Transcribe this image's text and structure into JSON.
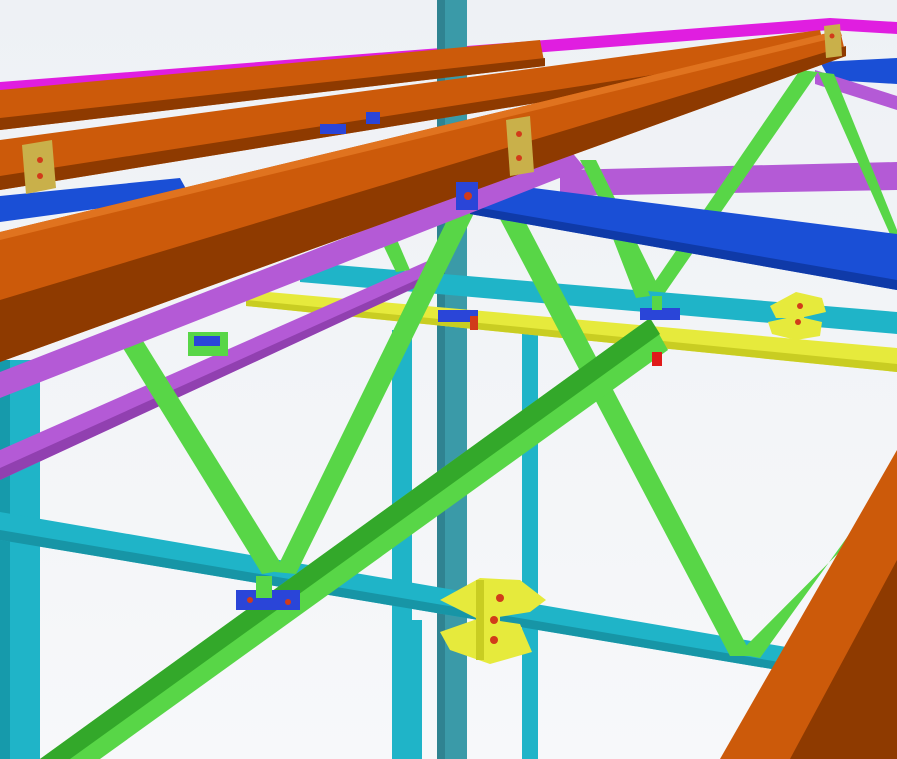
{
  "scene": {
    "description_type": "3D steel structure model render",
    "background": "#f4f6f9",
    "colors": {
      "purlin_orange": "#cc5a0a",
      "purlin_orange_dark": "#8e3a00",
      "rafter_blue": "#1a4fd6",
      "bracing_green": "#58d647",
      "bracing_green_dark": "#33a82a",
      "beam_purple": "#b45ad6",
      "column_cyan": "#1fb4c8",
      "tie_yellow": "#e6ea3c",
      "top_magenta": "#e01ee0",
      "column_teal": "#3a9aa8",
      "connection_plate": "#2a45d8",
      "bolt": "#d13b1a"
    }
  }
}
